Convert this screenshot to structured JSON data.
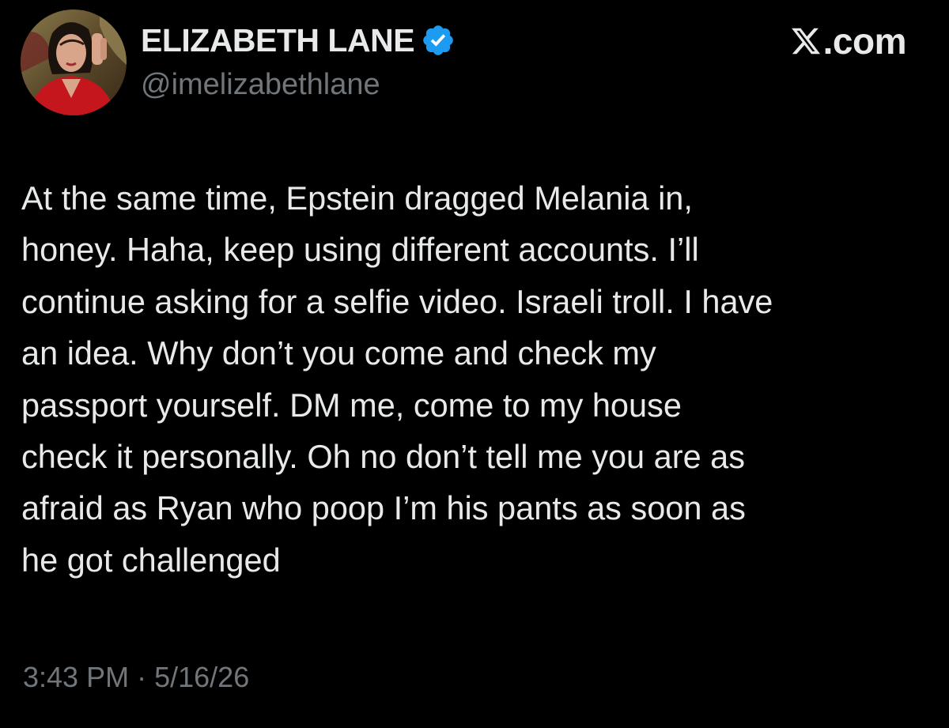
{
  "post": {
    "author": {
      "display_name": "ELIZABETH LANE",
      "handle": "@imelizabethlane",
      "verified": true,
      "avatar_icon": "profile-photo"
    },
    "source": {
      "site": ".com",
      "logo_icon": "x-logo-icon"
    },
    "text": "At the same time, Epstein dragged Melania  in,\nhoney. Haha, keep using different accounts. I’ll\ncontinue asking for a selfie video. Israeli troll. I have\nan idea. Why don’t you come and check my\npassport yourself. DM me, come to my house\ncheck it personally. Oh no don’t tell me you are as\nafraid as Ryan who poop I’m his pants as soon as\nhe got challenged",
    "time": "3:43 PM",
    "separator": "·",
    "date": "5/16/26"
  },
  "colors": {
    "background": "#000000",
    "text_primary": "#e7e9ea",
    "text_secondary": "#71767b",
    "verified_blue": "#1d9bf0"
  }
}
